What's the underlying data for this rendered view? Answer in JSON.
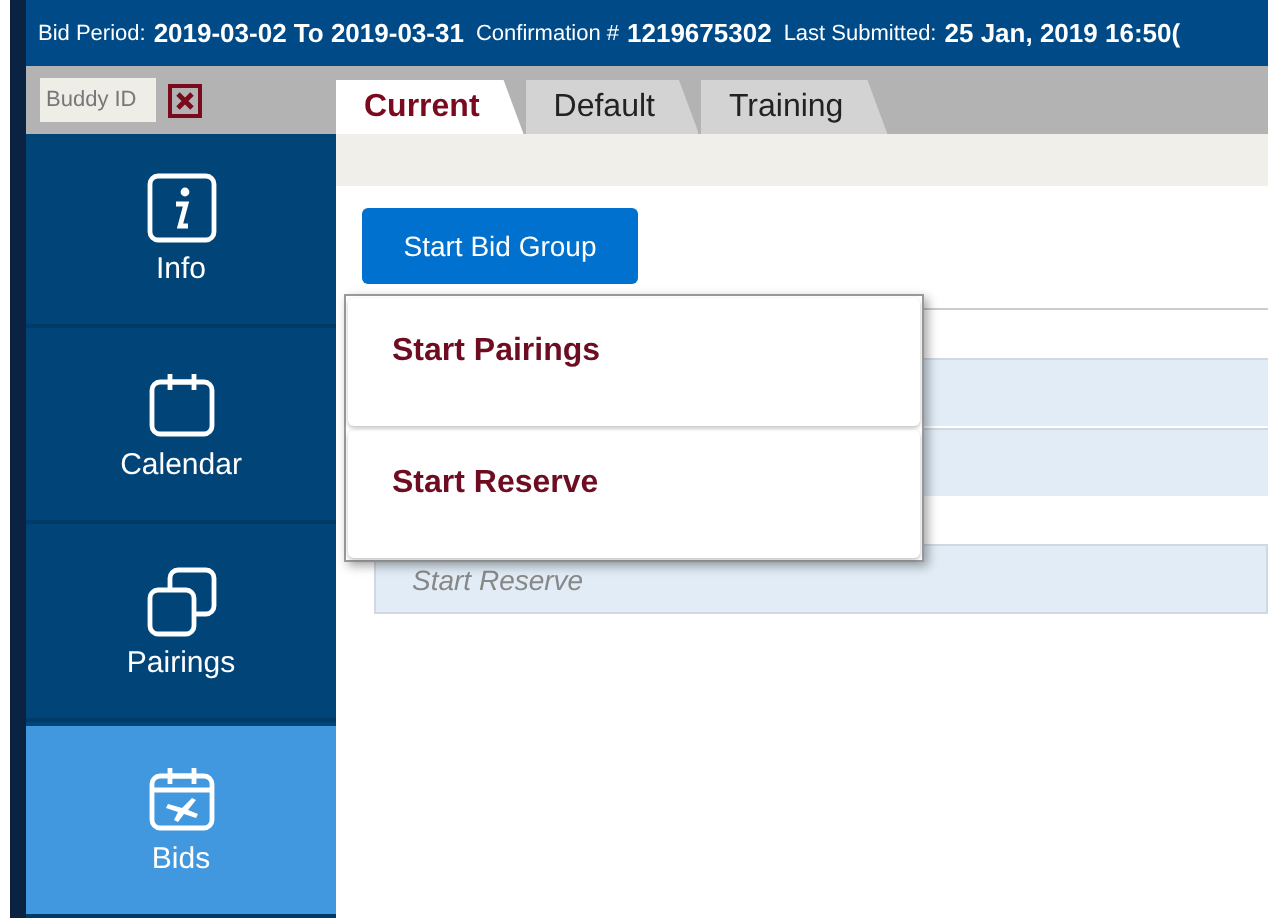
{
  "header": {
    "fields": [
      {
        "label": "Bid Period:",
        "value": "2019-03-02 To 2019-03-31"
      },
      {
        "label": "Confirmation #",
        "value": "1219675302"
      },
      {
        "label": "Last Submitted:",
        "value": "25 Jan, 2019 16:50("
      }
    ]
  },
  "buddy": {
    "placeholder": "Buddy ID"
  },
  "tabs": [
    {
      "label": "Current",
      "selected": true
    },
    {
      "label": "Default",
      "selected": false
    },
    {
      "label": "Training",
      "selected": false
    }
  ],
  "sidebar": {
    "items": [
      {
        "label": "Info",
        "kind": "info",
        "selected": false
      },
      {
        "label": "Calendar",
        "kind": "calendar",
        "selected": false
      },
      {
        "label": "Pairings",
        "kind": "pairings",
        "selected": false
      },
      {
        "label": "Bids",
        "kind": "bids",
        "selected": true
      }
    ]
  },
  "start_button": "Start Bid Group",
  "menu": {
    "items": [
      "Start Pairings",
      "Start Reserve"
    ]
  },
  "rows": [
    {
      "placeholder": "Start Reserve"
    }
  ]
}
